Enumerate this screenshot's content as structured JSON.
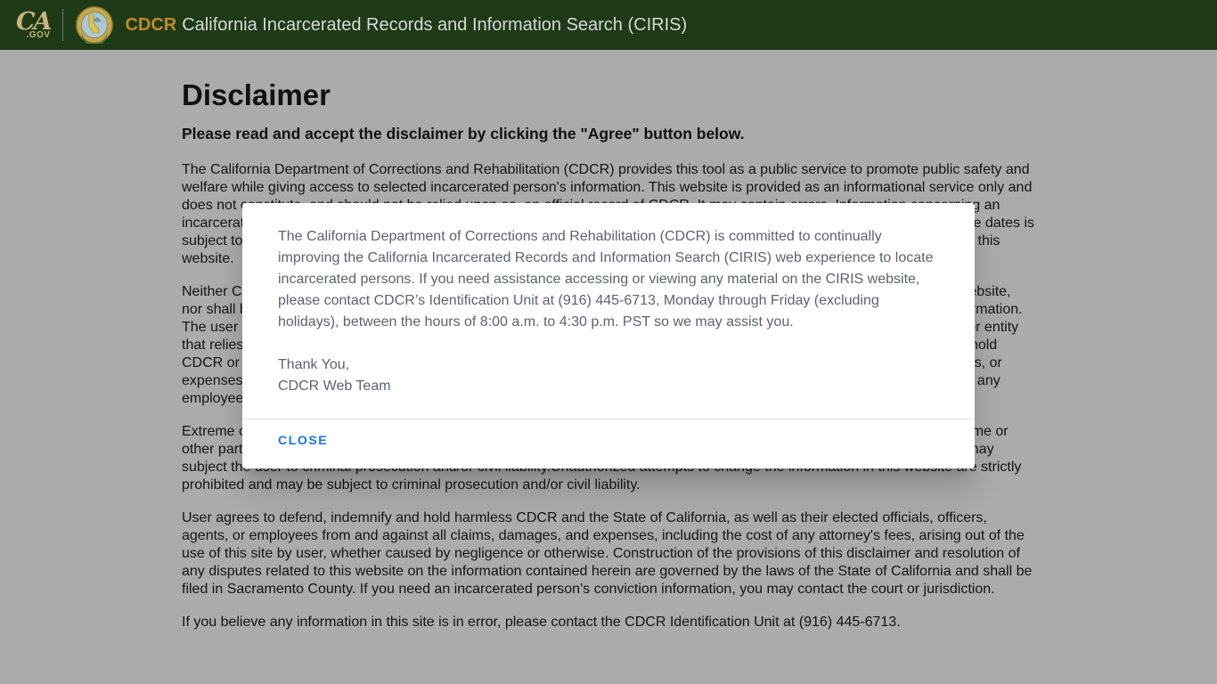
{
  "header": {
    "logo_ca": "CA",
    "logo_gov": ".GOV",
    "brand_cdcr": "CDCR",
    "brand_title": "California Incarcerated Records and Information Search (CIRIS)",
    "bg_color": "#1e3a17",
    "cdcr_accent_color": "#bf8a2d"
  },
  "page": {
    "title": "Disclaimer",
    "subtitle": "Please read and accept the disclaimer by clicking the \"Agree\" button below.",
    "paragraphs": [
      "The California Department of Corrections and Rehabilitation (CDCR) provides this tool as a public service to promote public safety and welfare while giving access to selected incarcerated person's information. This website is provided as an informational service only and does not constitute, and should not be relied upon as, an official record of CDCR. It may contain errors. Information concerning an incarcerated person's latest conviction(s), commitment county, admitted date, current location, and scheduled parole or release dates is subject to change. CDCR makes no guarantee as to the accuracy, completeness, or timeliness of the information contained in this website.",
      "Neither CDCR nor the State of California warrants the accuracy, reliability, or timeliness of any information published in this website, nor shall be held responsible for any errors or omissions in such information, or any losses caused by reliance upon such information. The user shall assume all responsibility and risk for the use of this website and the information contained herein. Any person or entity that relies on any information obtained from this website, whether acting on behalf of or with the consent of the user, may not hold CDCR or the State of California, as well as their elected officials, officers, agents, or employees, liable for any claims, damages, or expenses, arising out of the use of, or reliance on, the information provided in this website. CDCR, the State of California, and any employees thereof assume no liability for any improper or incorrect use of the information contained in this website.",
      "Extreme care should be exercised when using this website to identify an incarcerated person, since identifying solely upon name or other partial information may produce inaccurate results. Any improper or unauthorized use of the information in this website may subject the user to criminal prosecution and/or civil liability.Unauthorized attempts to change the information in this website are strictly prohibited and may be subject to criminal prosecution and/or civil liability.",
      "User agrees to defend, indemnify and hold harmless CDCR and the State of California, as well as their elected officials, officers, agents, or employees from and against all claims, damages, and expenses, including the cost of any attorney's fees, arising out of the use of this site by user, whether caused by negligence or otherwise. Construction of the provisions of this disclaimer and resolution of any disputes related to this website on the information contained herein are governed by the laws of the State of California and shall be filed in Sacramento County. If you need an incarcerated person's conviction information, you may contact the court or jurisdiction.",
      "If you believe any information in this site is in error, please contact the CDCR Identification Unit at (916) 445-6713."
    ]
  },
  "modal": {
    "body": "The California Department of Corrections and Rehabilitation (CDCR) is committed to continually improving the California Incarcerated Records and Information Search (CIRIS) web experience to locate incarcerated persons. If you need assistance accessing or viewing any material on the CIRIS website, please contact CDCR’s Identification Unit at (916) 445-6713, Monday through Friday (excluding holidays), between the hours of 8:00 a.m. to 4:30 p.m. PST so we may assist you.",
    "signoff_line1": "Thank You,",
    "signoff_line2": "CDCR Web Team",
    "close_label": "CLOSE",
    "close_color": "#1a73e8"
  }
}
